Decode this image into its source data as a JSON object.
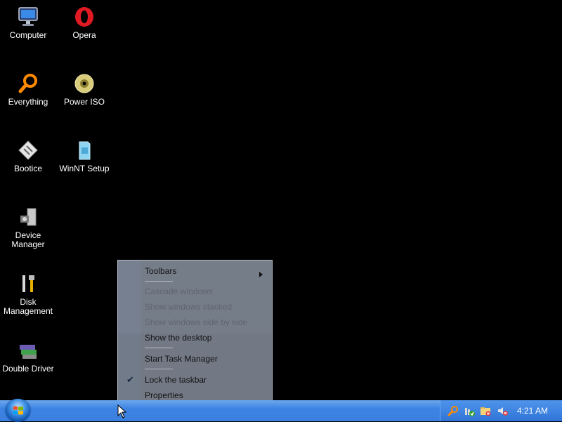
{
  "desktop": {
    "icons": [
      {
        "label": "Computer",
        "icon": "computer-icon"
      },
      {
        "label": "Opera",
        "icon": "opera-icon"
      },
      {
        "label": "Everything",
        "icon": "search-icon"
      },
      {
        "label": "Power ISO",
        "icon": "disc-icon"
      },
      {
        "label": "Bootice",
        "icon": "bootice-icon"
      },
      {
        "label": "WinNT Setup",
        "icon": "winnt-setup-icon"
      },
      {
        "label": "Device Manager",
        "icon": "device-manager-icon"
      },
      {
        "label": "Disk Management",
        "icon": "disk-management-icon"
      },
      {
        "label": "Double Driver",
        "icon": "double-driver-icon"
      }
    ]
  },
  "context_menu": {
    "items": [
      {
        "label": "Toolbars",
        "enabled": true,
        "submenu": true
      },
      {
        "label": "Cascade windows",
        "enabled": false
      },
      {
        "label": "Show windows stacked",
        "enabled": false
      },
      {
        "label": "Show windows side by side",
        "enabled": false
      },
      {
        "label": "Show the desktop",
        "enabled": true
      },
      {
        "label": "Start Task Manager",
        "enabled": true
      },
      {
        "label": "Lock the taskbar",
        "enabled": true,
        "checked": true
      },
      {
        "label": "Properties",
        "enabled": true
      }
    ]
  },
  "taskbar": {
    "start_button": "start-orb-icon",
    "tray_icons": [
      "search-icon",
      "shield-check-icon",
      "folder-icon",
      "speaker-muted-icon"
    ],
    "clock": "4:21 AM"
  },
  "colors": {
    "taskbar": "#3b7fdf",
    "desktop": "#000000",
    "menu": "#9aa2b0"
  }
}
